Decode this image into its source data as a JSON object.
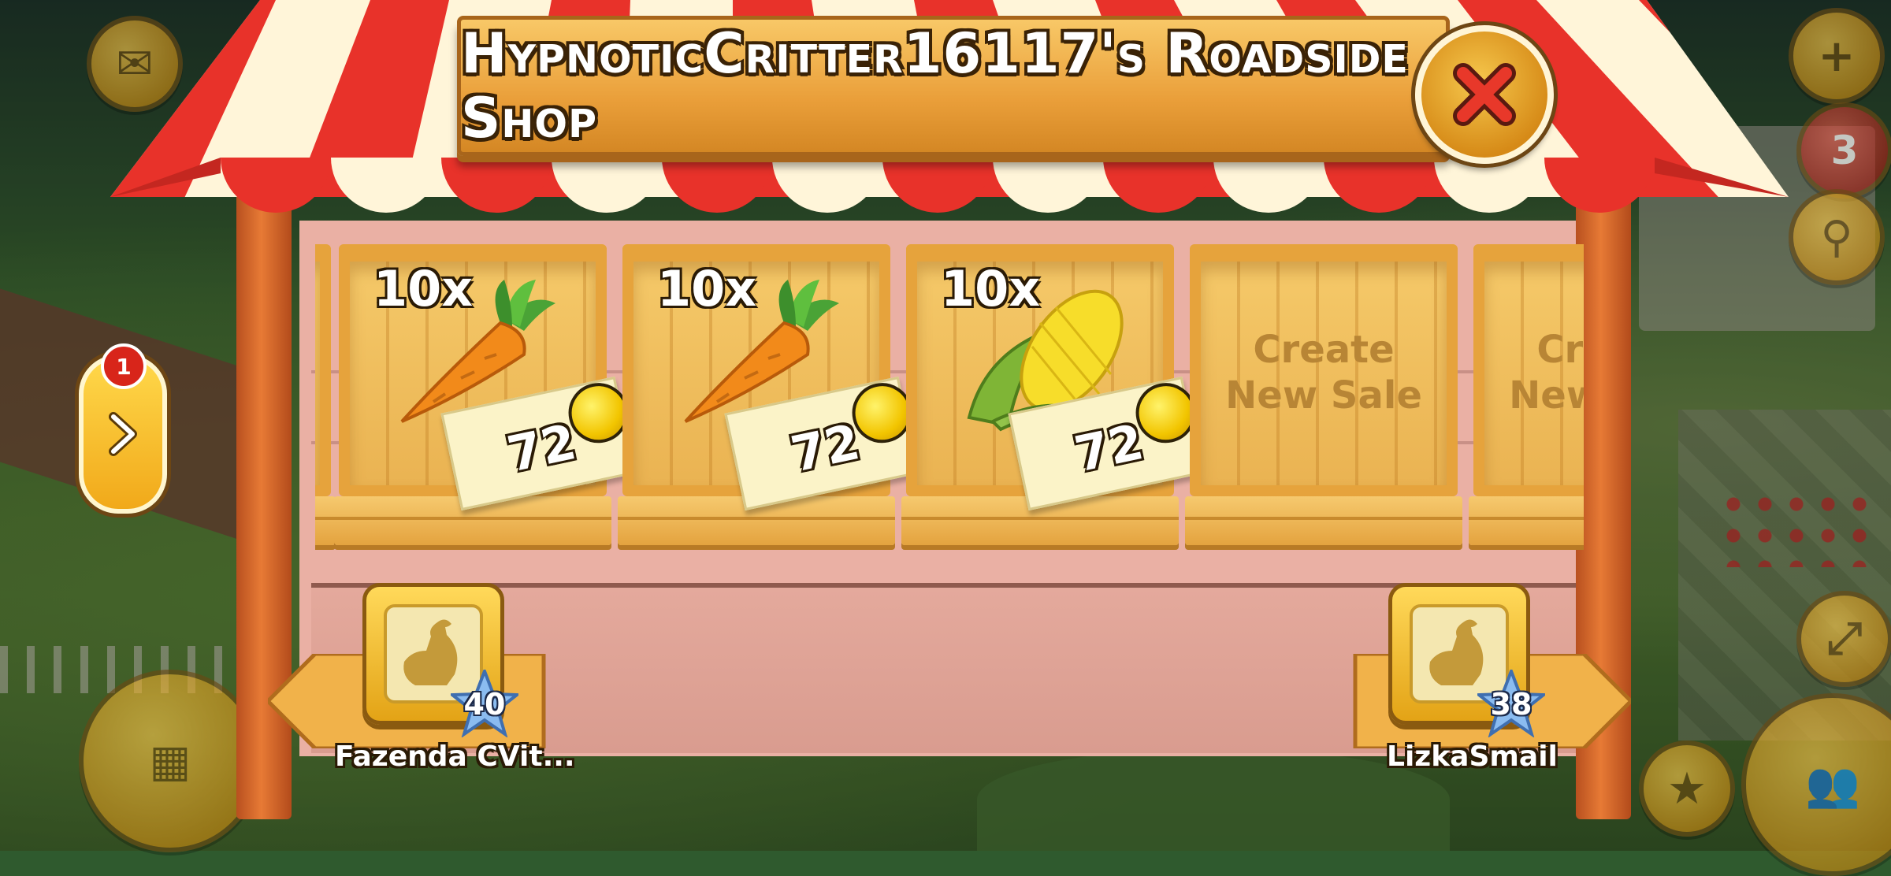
{
  "shop": {
    "title": "HypnoticCritter16117's Roadside Shop"
  },
  "sales": [
    {
      "quantity": "10x",
      "item": "carrot",
      "price": "72"
    },
    {
      "quantity": "10x",
      "item": "carrot",
      "price": "72"
    },
    {
      "quantity": "10x",
      "item": "corn",
      "price": "72"
    }
  ],
  "empty_slots": [
    {
      "label_line1": "Create",
      "label_line2": "New Sale"
    },
    {
      "label_line1": "Create",
      "label_line2": "New Sale"
    }
  ],
  "neighbors": {
    "previous": {
      "name": "Fazenda CVit...",
      "level": "40"
    },
    "next": {
      "name": "LizkaSmail",
      "level": "38"
    }
  },
  "side_tab": {
    "badge_count": "1"
  },
  "hud": {
    "notification_count": "3"
  },
  "colors": {
    "awning_red": "#e8322a",
    "awning_cream": "#fff5d9",
    "wood_orange": "#ea9f3a",
    "coin_gold": "#f2c500"
  },
  "icons": [
    "close-icon",
    "coin-icon",
    "carrot-icon",
    "corn-icon",
    "rooster-avatar-icon",
    "level-star-icon",
    "chevron-right-icon",
    "mail-icon",
    "plus-icon",
    "magnifier-icon",
    "cash-register-icon",
    "friends-icon"
  ]
}
